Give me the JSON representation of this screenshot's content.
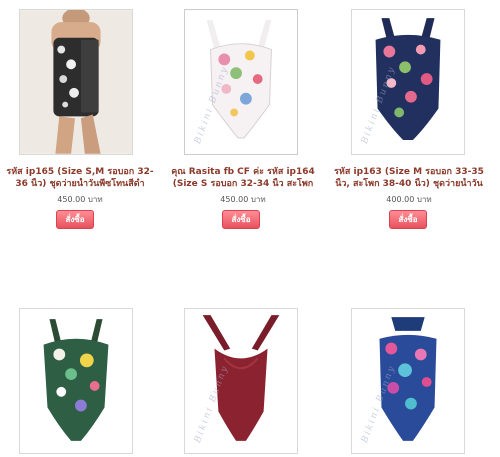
{
  "products": [
    {
      "title_line1": "รหัส ip165 (Size S,M รอบอก 32-",
      "title_line2": "36 นิ้ว) ชุดว่ายน้ำวันพีซโทนสีดำ",
      "price": "450.00 บาท",
      "button": "สั่งซื้อ"
    },
    {
      "title_line1": "คุณ Rasita fb CF ค่ะ รหัส ip164",
      "title_line2": "(Size S รอบอก 32-34 นิ้ว สะโพก",
      "price": "450.00 บาท",
      "button": "สั่งซื้อ"
    },
    {
      "title_line1": "รหัส ip163 (Size M รอบอก 33-35",
      "title_line2": "นิ้ว, สะโพก 38-40 นิ้ว) ชุดว่ายน้ำวัน",
      "price": "400.00 บาท",
      "button": "สั่งซื้อ"
    }
  ],
  "watermark": "Bikini Bunny",
  "colors": {
    "title": "#8b3a2a",
    "button": "#e8525e"
  }
}
